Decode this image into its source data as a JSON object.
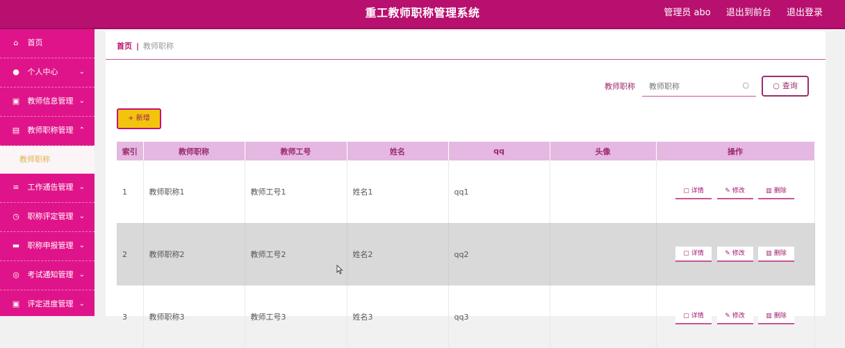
{
  "header": {
    "title": "重工教师职称管理系统",
    "admin": "管理员 abo",
    "to_front": "退出到前台",
    "logout": "退出登录"
  },
  "sidebar": {
    "items": [
      {
        "label": "首页",
        "icon": "home-icon"
      },
      {
        "label": "个人中心",
        "icon": "user-icon"
      },
      {
        "label": "教师信息管理",
        "icon": "clipboard-icon"
      },
      {
        "label": "教师职称管理",
        "icon": "list-icon"
      },
      {
        "label": "教师职称",
        "icon": ""
      },
      {
        "label": "工作通告管理",
        "icon": "menu-icon"
      },
      {
        "label": "职称评定管理",
        "icon": "clock-icon"
      },
      {
        "label": "职称申报管理",
        "icon": "briefcase-icon"
      },
      {
        "label": "考试通知管理",
        "icon": "settings-icon"
      },
      {
        "label": "评定进度管理",
        "icon": "clipboard-icon"
      }
    ]
  },
  "breadcrumb": {
    "home": "首页",
    "sep": "|",
    "current": "教师职称"
  },
  "search": {
    "label": "教师职称",
    "placeholder": "教师职称",
    "button": "查询"
  },
  "toolbar": {
    "add": "+ 新增"
  },
  "table": {
    "headers": [
      "索引",
      "教师职称",
      "教师工号",
      "姓名",
      "qq",
      "头像",
      "操作"
    ],
    "rows": [
      [
        "1",
        "教师职称1",
        "教师工号1",
        "姓名1",
        "qq1",
        ""
      ],
      [
        "2",
        "教师职称2",
        "教师工号2",
        "姓名2",
        "qq2",
        ""
      ],
      [
        "3",
        "教师职称3",
        "教师工号3",
        "姓名3",
        "qq3",
        ""
      ]
    ],
    "ops": {
      "detail": "详情",
      "edit": "修改",
      "delete": "删除"
    }
  },
  "colors": {
    "brand": "#b8106f",
    "sidebar": "#e0148a",
    "table_header": "#e5b8e2",
    "add_button": "#f2c40c"
  }
}
